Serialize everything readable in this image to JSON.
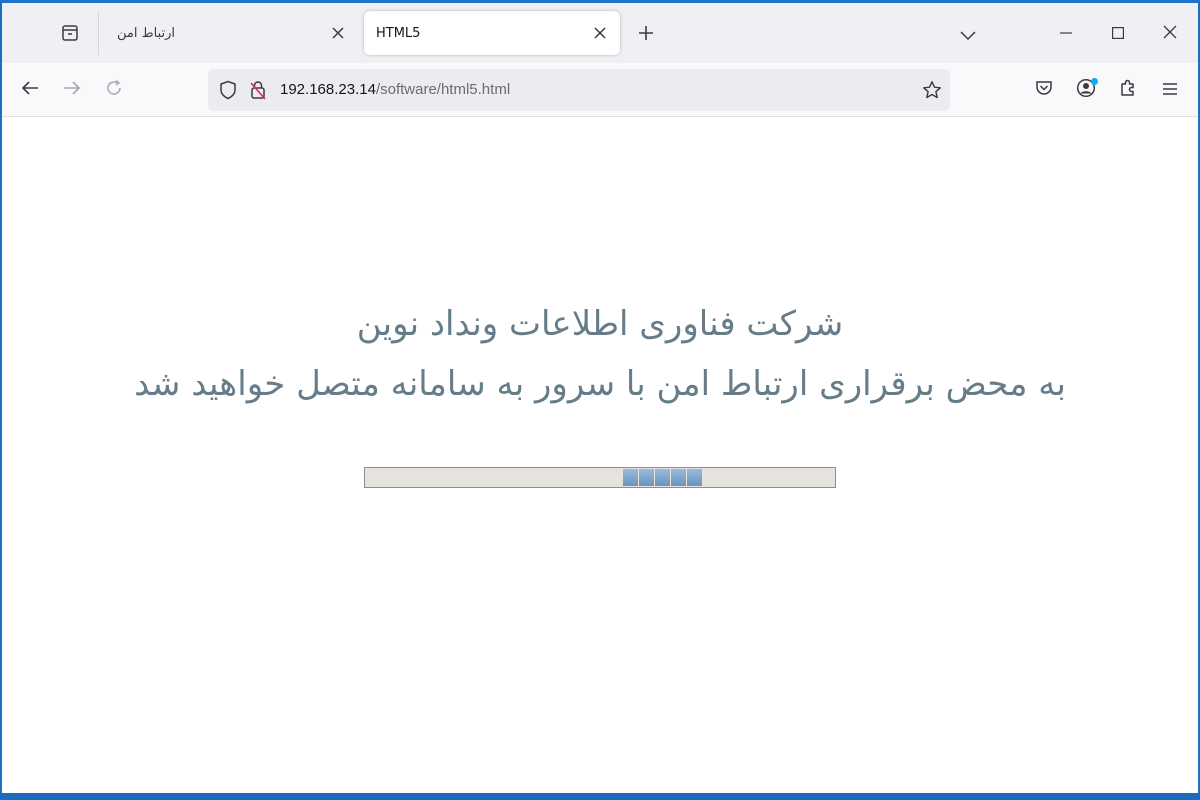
{
  "browser": {
    "tabs": [
      {
        "title": "ارتباط امن",
        "active": false
      },
      {
        "title": "HTML5",
        "active": true
      }
    ],
    "url": {
      "host": "192.168.23.14",
      "path": "/software/html5.html"
    },
    "icons": {
      "tab_overview": "firefox-view-icon",
      "tab_close": "close-icon",
      "new_tab": "plus-icon",
      "list_tabs": "chevron-down-icon",
      "minimize": "minimize-icon",
      "maximize": "maximize-icon",
      "window_close": "close-icon",
      "back": "back-arrow-icon",
      "forward": "forward-arrow-icon",
      "reload": "reload-icon",
      "tracking_protection": "shield-icon",
      "insecure_connection": "insecure-lock-icon",
      "bookmark": "star-icon",
      "pocket": "pocket-icon",
      "account": "account-icon",
      "extensions": "puzzle-icon",
      "menu": "hamburger-menu-icon"
    },
    "accent_color": "#00b3f4"
  },
  "page": {
    "line1": "شرکت فناوری اطلاعات ونداد نوین",
    "line2": "به محض برقراری ارتباط امن با سرور به سامانه متصل خواهید شد",
    "text_color": "#667d89",
    "progress": {
      "type": "indeterminate-marquee",
      "chunk_color": "#7aa3cc"
    }
  }
}
